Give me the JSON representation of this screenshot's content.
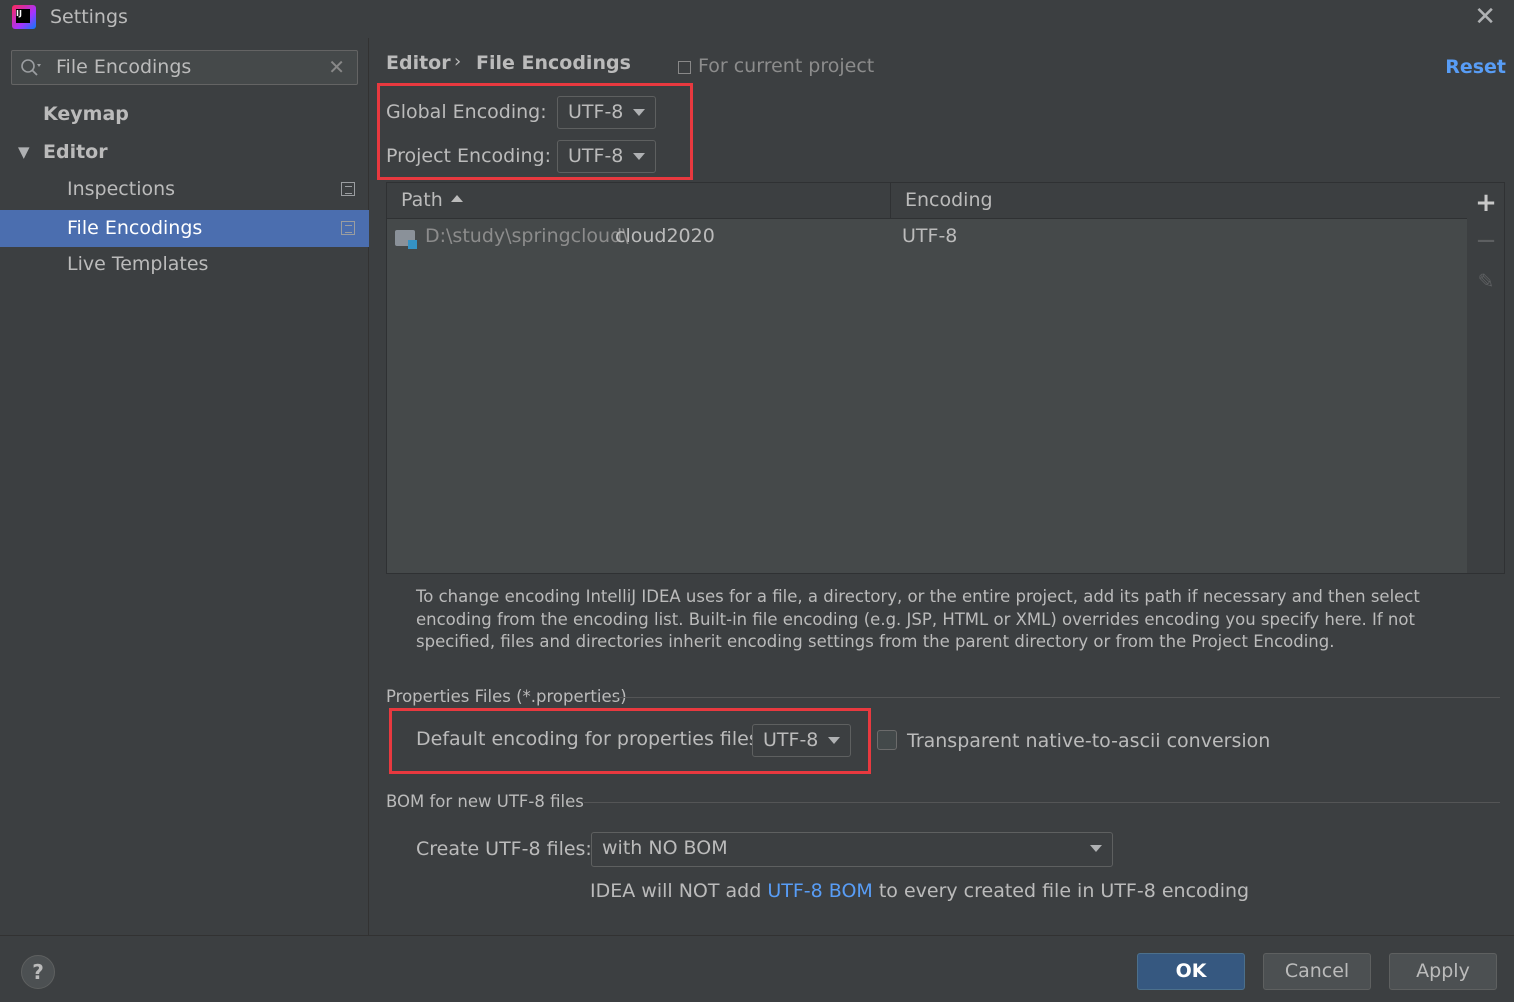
{
  "window": {
    "title": "Settings"
  },
  "sidebar": {
    "search_value": "File Encodings",
    "items": [
      {
        "label": "Keymap"
      },
      {
        "label": "Editor"
      },
      {
        "label": "Inspections"
      },
      {
        "label": "File Encodings"
      },
      {
        "label": "Live Templates"
      }
    ]
  },
  "header": {
    "crumb1": "Editor",
    "crumb_sep": "›",
    "crumb2": "File Encodings",
    "scope": "For current project",
    "reset": "Reset"
  },
  "encodings": {
    "global_label": "Global Encoding:",
    "global_value": "UTF-8",
    "project_label": "Project Encoding:",
    "project_value": "UTF-8"
  },
  "table": {
    "columns": [
      "Path",
      "Encoding"
    ],
    "rows": [
      {
        "path_prefix": "D:\\study\\springcloud\\",
        "path_name": "cloud2020",
        "encoding": "UTF-8"
      }
    ]
  },
  "help_text": "To change encoding IntelliJ IDEA uses for a file, a directory, or the entire project, add its path if necessary and then select encoding from the encoding list. Built-in file encoding (e.g. JSP, HTML or XML) overrides encoding you specify here. If not specified, files and directories inherit encoding settings from the parent directory or from the Project Encoding.",
  "properties": {
    "section_title": "Properties Files (*.properties)",
    "default_label": "Default encoding for properties files:",
    "default_value": "UTF-8",
    "transparent_label": "Transparent native-to-ascii conversion",
    "transparent_checked": false
  },
  "bom": {
    "section_title": "BOM for new UTF-8 files",
    "create_label": "Create UTF-8 files:",
    "create_value": "with NO BOM",
    "note_prefix": "IDEA will NOT add ",
    "note_link": "UTF-8 BOM",
    "note_suffix": " to every created file in UTF-8 encoding"
  },
  "buttons": {
    "ok": "OK",
    "cancel": "Cancel",
    "apply": "Apply",
    "help": "?"
  },
  "colors": {
    "accent": "#4b6eaf",
    "link": "#589df6",
    "highlight_box": "#e8393f"
  }
}
